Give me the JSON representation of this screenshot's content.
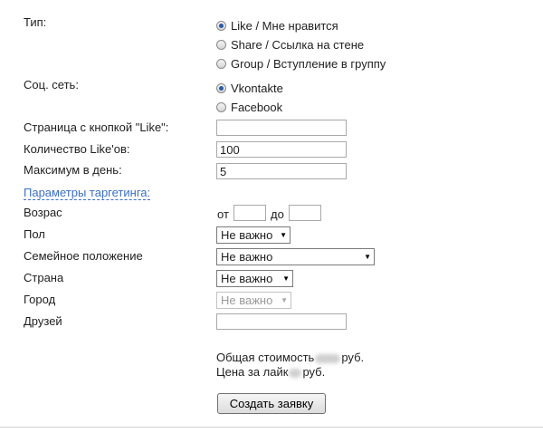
{
  "type_section": {
    "label": "Тип:",
    "options": [
      {
        "label": "Like / Мне нравится",
        "checked": true
      },
      {
        "label": "Share / Ссылка на стене",
        "checked": false
      },
      {
        "label": "Group / Вступление в группу",
        "checked": false
      }
    ]
  },
  "network_section": {
    "label": "Соц. сеть:",
    "options": [
      {
        "label": "Vkontakte",
        "checked": true
      },
      {
        "label": "Facebook",
        "checked": false
      }
    ]
  },
  "fields": {
    "like_page_label": "Страница с кнопкой \"Like\":",
    "like_page_value": "",
    "likes_count_label": "Количество Like'ов:",
    "likes_count_value": "100",
    "max_per_day_label": "Максимум в день:",
    "max_per_day_value": "5"
  },
  "targeting": {
    "link_label": "Параметры таргетинга:",
    "age_label": "Возрас",
    "age_from_label": "от",
    "age_to_label": "до",
    "gender_label": "Пол",
    "gender_value": "Не важно",
    "marital_label": "Семейное положение",
    "marital_value": "Не важно",
    "country_label": "Страна",
    "country_value": "Не важно",
    "city_label": "Город",
    "city_value": "Не важно",
    "friends_label": "Друзей"
  },
  "pricing": {
    "total_prefix": "Общая стоимость",
    "total_suffix": "руб.",
    "per_like_prefix": "Цена за лайк",
    "per_like_suffix": "руб."
  },
  "submit_label": "Создать заявку",
  "icons": {
    "select_caret": "chevron-down-icon"
  }
}
